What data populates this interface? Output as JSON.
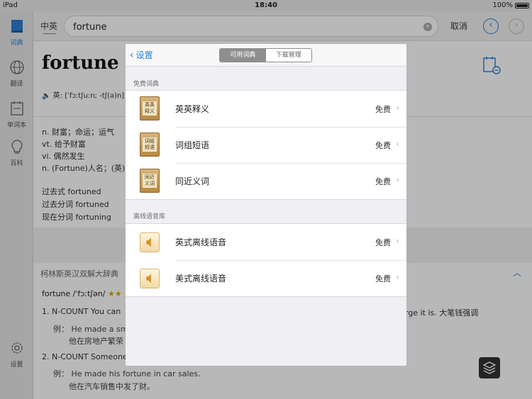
{
  "status": {
    "device": "iPad",
    "time": "18:40",
    "battery": "100%"
  },
  "sidebar": {
    "items": [
      {
        "label": "词典"
      },
      {
        "label": "翻译"
      },
      {
        "label": "单词本"
      },
      {
        "label": "百科"
      }
    ],
    "settings_label": "设置"
  },
  "topbar": {
    "lang": "中英",
    "search_value": "fortune",
    "cancel": "取消"
  },
  "main": {
    "word": "fortune",
    "pron": "英: [ˈfɔːtʃuːn; -tʃ(ə)n]",
    "defs": [
      "n. 财富；命运；运气",
      "vt. 给予财富",
      "vi. 偶然发生",
      "n. (Fortune)人名；(英)"
    ],
    "forms": [
      "过去式 fortuned",
      "过去分词 fortuned",
      "现在分词 fortuning"
    ],
    "collins_title": "柯林斯英汉双解大辞典",
    "entry_word": "fortune",
    "entry_pron": "/ˈfɔːtʃən/",
    "entry_stars": "★★",
    "sense1": "1. N-COUNT You can",
    "sense1_tail": "ow large it is. 大笔钱强调",
    "ex1_prefix": "例：",
    "ex1_en": "He made a sma",
    "ex1_cn": "他在房地产繁荣",
    "sense2": "2. N-COUNT Someone",
    "ex2_prefix": "例：",
    "ex2_en": "He made his fortune in car sales.",
    "ex2_cn": "他在汽车销售中发了财。"
  },
  "sheet": {
    "back": "设置",
    "tabs": [
      "可用词典",
      "下载管理"
    ],
    "free_section": "免费词典",
    "free_items": [
      {
        "name": "英英释义",
        "icon_text": "英英释义",
        "price": "免费"
      },
      {
        "name": "词组短语",
        "icon_text": "词组短语",
        "price": "免费"
      },
      {
        "name": "同近义词",
        "icon_text": "同近义词",
        "price": "免费"
      }
    ],
    "offline_section": "离线语音库",
    "offline_items": [
      {
        "name": "英式离线语音",
        "price": "免费"
      },
      {
        "name": "美式离线语音",
        "price": "免费"
      }
    ]
  },
  "colors": {
    "accent": "#2b7fd0",
    "overlay": "rgba(0,0,0,0.28)"
  }
}
